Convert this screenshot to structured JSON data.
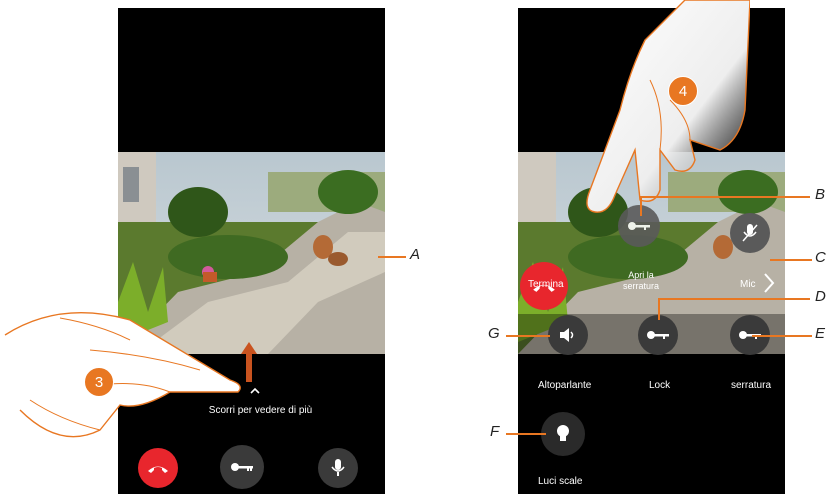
{
  "left_screen": {
    "hint_text": "Scorri per vedere di più",
    "buttons": [
      "end-call",
      "lock",
      "microphone"
    ]
  },
  "right_screen": {
    "overlay_labels": {
      "end": "Termina",
      "open_lock": "Apri la serratura",
      "mic": "Mic"
    },
    "actions": [
      {
        "label": "Altoparlante"
      },
      {
        "label": "Lock"
      },
      {
        "label": "serratura"
      }
    ],
    "stairs_light": {
      "label": "Luci scale"
    }
  },
  "callouts": {
    "a": "A",
    "b": "B",
    "c": "C",
    "d": "D",
    "e": "E",
    "f": "F",
    "g": "G"
  },
  "steps": {
    "left": "3",
    "right": "4"
  },
  "colors": {
    "accent": "#e87722",
    "end_call": "#e8262d",
    "button_grey": "#3a3a3a",
    "overlay_grey": "#5a5a5a"
  }
}
